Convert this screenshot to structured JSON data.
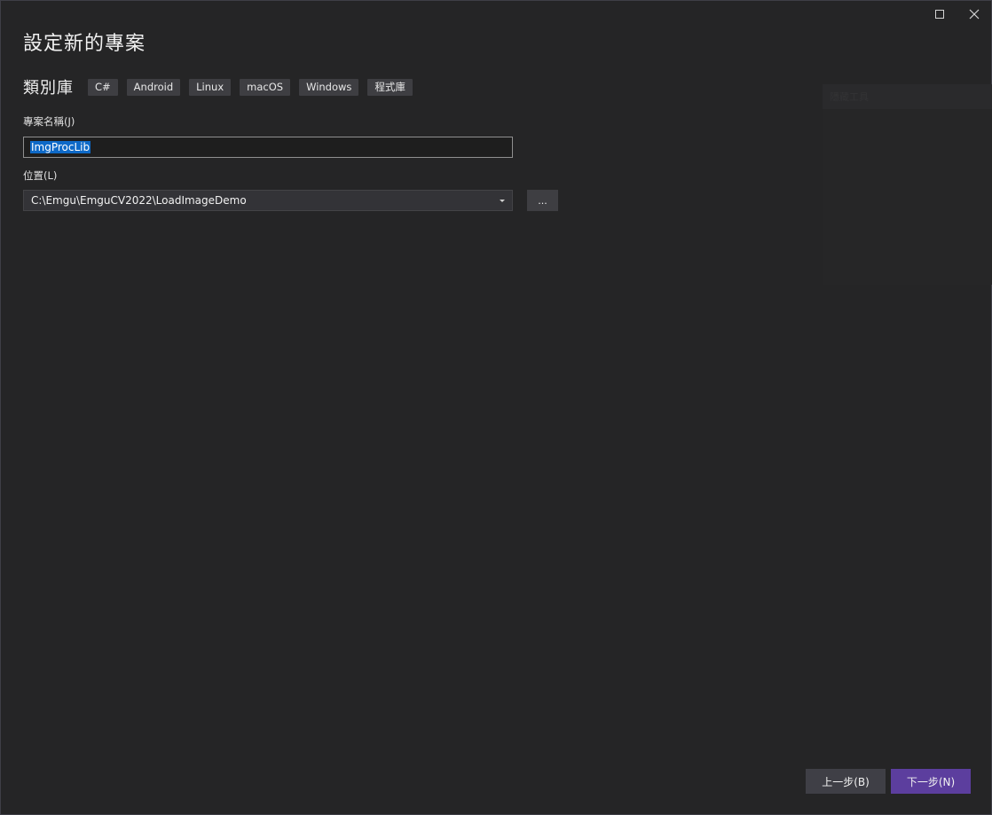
{
  "window": {
    "title": "設定新的專案"
  },
  "template": {
    "name": "類別庫",
    "tags": [
      "C#",
      "Android",
      "Linux",
      "macOS",
      "Windows",
      "程式庫"
    ]
  },
  "fields": {
    "name_label": "專案名稱(J)",
    "name_value": "ImgProcLib",
    "location_label": "位置(L)",
    "location_value": "C:\\Emgu\\EmguCV2022\\LoadImageDemo",
    "browse_label": "..."
  },
  "ghost_panel": {
    "header_text": "隱藏工具"
  },
  "footer": {
    "back_label": "上一步(B)",
    "next_label": "下一步(N)"
  },
  "colors": {
    "background": "#252526",
    "accent": "#5c3e9e",
    "selection": "#0e69c7"
  }
}
